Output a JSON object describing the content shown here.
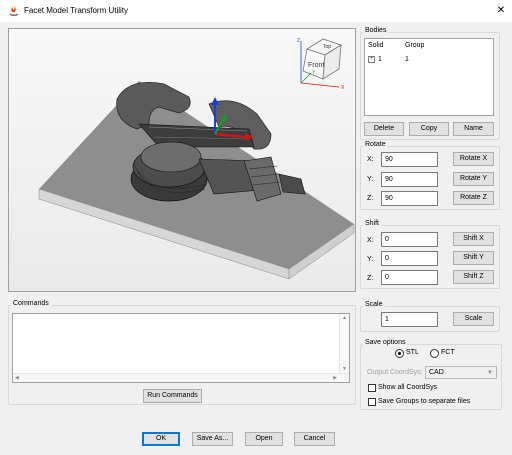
{
  "window": {
    "title": "Facet Model Transform Utility",
    "close_glyph": "✕"
  },
  "bodies": {
    "label": "Bodies",
    "columns": [
      "Solid",
      "Group"
    ],
    "rows": [
      {
        "solid": "1",
        "group": "1",
        "expander": "+"
      }
    ],
    "buttons": {
      "delete": "Delete",
      "copy": "Copy",
      "name": "Name"
    }
  },
  "rotate": {
    "label": "Rotate",
    "x_label": "X:",
    "y_label": "Y:",
    "z_label": "Z:",
    "x_value": "90",
    "y_value": "90",
    "z_value": "90",
    "x_button": "Rotate X",
    "y_button": "Rotate Y",
    "z_button": "Rotate Z"
  },
  "shift": {
    "label": "Shift",
    "x_label": "X:",
    "y_label": "Y:",
    "z_label": "Z:",
    "x_value": "0",
    "y_value": "0",
    "z_value": "0",
    "x_button": "Shift X",
    "y_button": "Shift Y",
    "z_button": "Shift Z"
  },
  "scale": {
    "label": "Scale",
    "value": "1",
    "button": "Scale"
  },
  "save_options": {
    "label": "Save options",
    "stl_label": "STL",
    "fct_label": "FCT",
    "selected": "STL",
    "output_coordsys_label": "Output CoordSys:",
    "output_coordsys_value": "CAD",
    "show_all_coordsys": "Show all CoordSys",
    "save_groups": "Save Groups to separate files"
  },
  "commands": {
    "label": "Commands",
    "text": "",
    "run_button": "Run Commands"
  },
  "footer": {
    "ok": "OK",
    "save_as": "Save As...",
    "open": "Open",
    "cancel": "Cancel"
  },
  "viewcube": {
    "top_label": "Top",
    "front_label": "Front"
  },
  "triad": {
    "x_label": "X",
    "y_label": "Y",
    "z_label": "Z"
  },
  "colors": {
    "axis_x": "#e01010",
    "axis_y": "#10a020",
    "axis_z": "#1a3fe0",
    "accent": "#0078d7"
  }
}
